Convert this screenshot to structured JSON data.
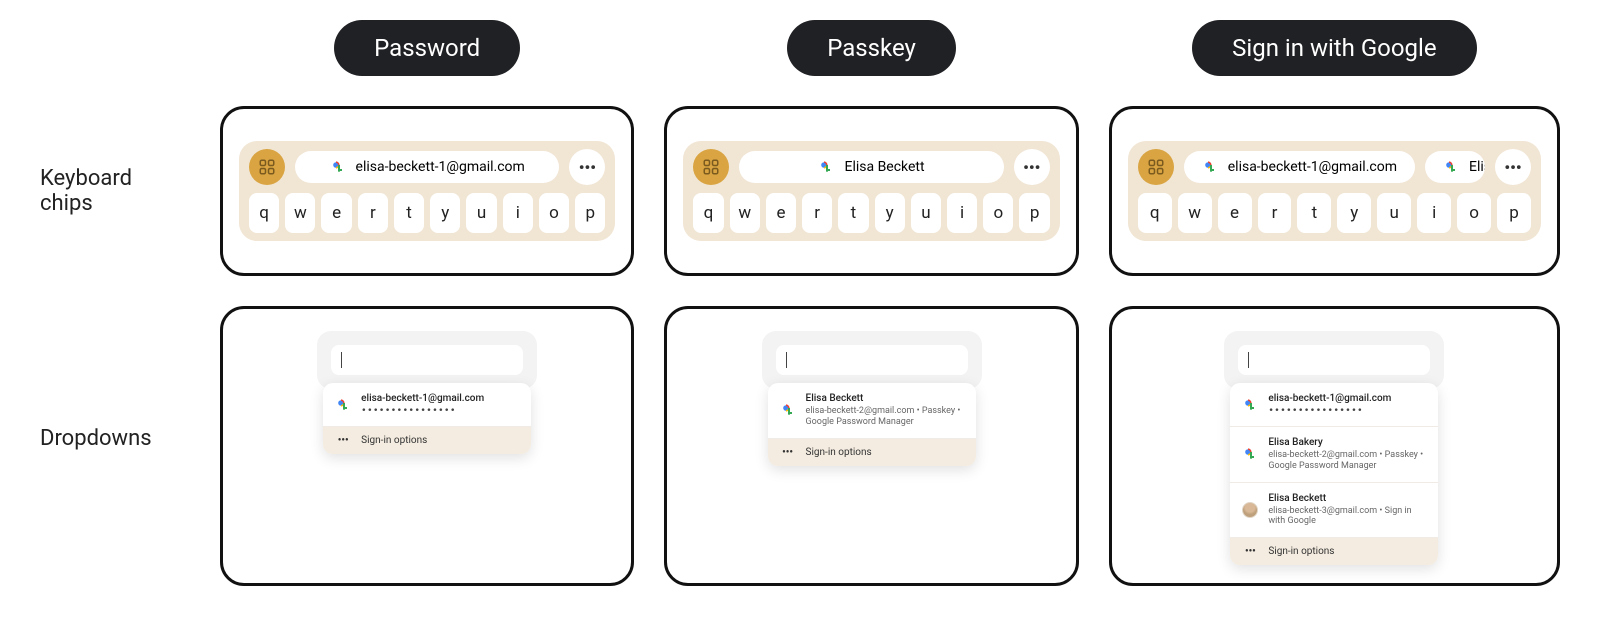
{
  "columns": [
    {
      "label": "Password"
    },
    {
      "label": "Passkey"
    },
    {
      "label": "Sign in with Google"
    }
  ],
  "row_labels": {
    "chips": "Keyboard chips",
    "dropdowns": "Dropdowns"
  },
  "keys": [
    "q",
    "w",
    "e",
    "r",
    "t",
    "y",
    "u",
    "i",
    "o",
    "p"
  ],
  "chips": {
    "password": {
      "text": "elisa-beckett-1@gmail.com"
    },
    "passkey": {
      "text": "Elisa Beckett"
    },
    "google": {
      "text1": "elisa-beckett-1@gmail.com",
      "text2": "Elisa B"
    }
  },
  "password_mask": "••••••••••••••••",
  "signin_options": "Sign-in options",
  "dd": {
    "password": {
      "title": "elisa-beckett-1@gmail.com"
    },
    "passkey": {
      "title": "Elisa Beckett",
      "sub": "elisa-beckett-2@gmail.com • Passkey • Google Password Manager"
    },
    "google": {
      "item1": {
        "title": "elisa-beckett-1@gmail.com"
      },
      "item2": {
        "title": "Elisa Bakery",
        "sub": "elisa-beckett-2@gmail.com • Passkey • Google Password Manager"
      },
      "item3": {
        "title": "Elisa Beckett",
        "sub": "elisa-beckett-3@gmail.com • Sign in with Google"
      }
    }
  },
  "more_glyph": "•••"
}
